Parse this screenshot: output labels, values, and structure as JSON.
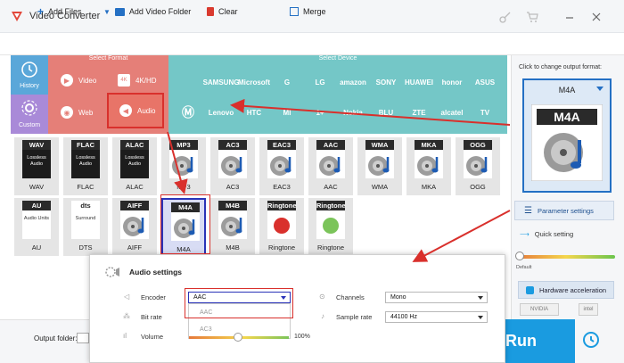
{
  "window": {
    "title": "Video Converter"
  },
  "toolbar": {
    "add_files": "Add Files",
    "add_video_folder": "Add Video Folder",
    "clear": "Clear",
    "merge": "Merge"
  },
  "sidebar": {
    "history": "History",
    "custom": "Custom"
  },
  "format_section": {
    "header": "Select Format",
    "buttons": [
      "Video",
      "4K/HD",
      "Web",
      "Audio"
    ]
  },
  "device_section": {
    "header": "Select Device",
    "brands_row1": [
      "",
      "SAMSUNG",
      "Microsoft",
      "G",
      "LG",
      "amazon",
      "SONY",
      "HUAWEI",
      "honor",
      "ASUS"
    ],
    "brands_row2": [
      "",
      "Lenovo",
      "HTC",
      "MI",
      "1+",
      "Nokia",
      "BLU",
      "ZTE",
      "alcatel",
      "TV"
    ]
  },
  "formats": [
    {
      "badge": "WAV",
      "label": "WAV",
      "sub": "Lossless Audio"
    },
    {
      "badge": "FLAC",
      "label": "FLAC",
      "sub": "Lossless Audio"
    },
    {
      "badge": "ALAC",
      "label": "ALAC",
      "sub": "Lossless Audio"
    },
    {
      "badge": "MP3",
      "label": "MP3"
    },
    {
      "badge": "AC3",
      "label": "AC3"
    },
    {
      "badge": "EAC3",
      "label": "EAC3"
    },
    {
      "badge": "AAC",
      "label": "AAC"
    },
    {
      "badge": "WMA",
      "label": "WMA"
    },
    {
      "badge": "MKA",
      "label": "MKA"
    },
    {
      "badge": "OGG",
      "label": "OGG"
    },
    {
      "badge": "AU",
      "label": "AU",
      "sub": "Audio Units"
    },
    {
      "badge": "dts",
      "label": "DTS",
      "sub": "Surround"
    },
    {
      "badge": "AIFF",
      "label": "AIFF"
    },
    {
      "badge": "M4A",
      "label": "M4A"
    },
    {
      "badge": "M4B",
      "label": "M4B"
    },
    {
      "badge": "Ringtone",
      "label": "Ringtone"
    },
    {
      "badge": "Ringtone",
      "label": "Ringtone"
    }
  ],
  "right_panel": {
    "click_label": "Click to change output format:",
    "output_format": "M4A",
    "parameter_settings": "Parameter settings",
    "quick_setting": "Quick setting",
    "default_label": "Default",
    "hardware_acceleration": "Hardware acceleration",
    "vendors": [
      "NVIDIA",
      "intel"
    ]
  },
  "bottom": {
    "output_folder_label": "Output folder:",
    "run": "Run"
  },
  "audio_settings": {
    "title": "Audio settings",
    "encoder_label": "Encoder",
    "encoder_value": "AAC",
    "encoder_options": [
      "AAC",
      "AC3"
    ],
    "bitrate_label": "Bit rate",
    "volume_label": "Volume",
    "volume_value": "100%",
    "channels_label": "Channels",
    "channels_value": "Mono",
    "sample_rate_label": "Sample rate",
    "sample_rate_value": "44100 Hz"
  },
  "colors": {
    "accent": "#1a9be0",
    "format_bg": "#e57f78",
    "device_bg": "#74c7c7",
    "highlight_red": "#d9302c",
    "selected_blue": "#2a33b8"
  }
}
